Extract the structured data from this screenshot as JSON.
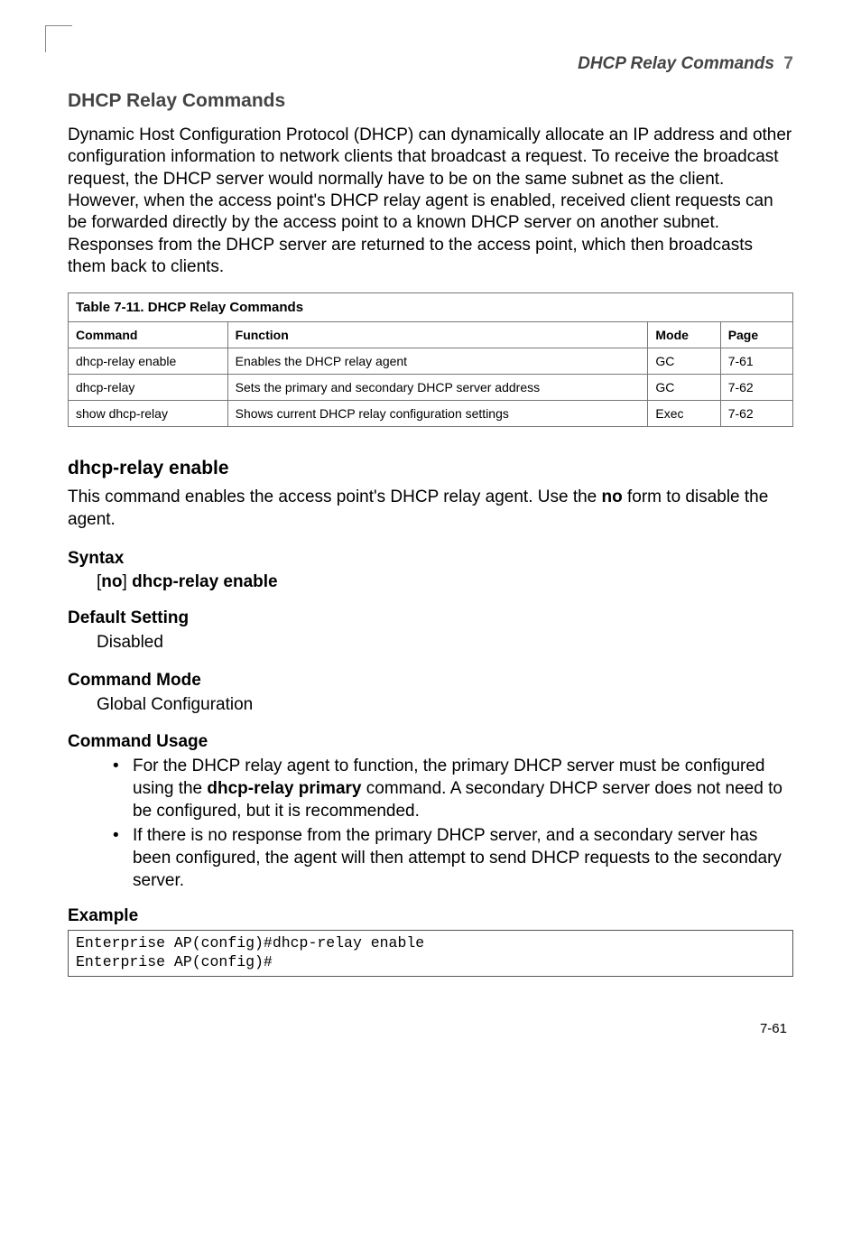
{
  "header": {
    "right": "DHCP Relay Commands",
    "chapter": "7"
  },
  "section": {
    "title": "DHCP Relay Commands",
    "intro": "Dynamic Host Configuration Protocol (DHCP) can dynamically allocate an IP address and other configuration information to network clients that broadcast a request. To receive the broadcast request, the DHCP server would normally have to be on the same subnet as the client. However, when the access point's DHCP relay agent is enabled, received client requests can be forwarded directly by the access point to a known DHCP server on another subnet. Responses from the DHCP server are returned to the access point, which then broadcasts them back to clients."
  },
  "table": {
    "caption": "Table 7-11. DHCP Relay Commands",
    "headers": [
      "Command",
      "Function",
      "Mode",
      "Page"
    ],
    "rows": [
      [
        "dhcp-relay enable",
        "Enables the DHCP relay agent",
        "GC",
        "7-61"
      ],
      [
        "dhcp-relay",
        "Sets the primary and secondary DHCP server address",
        "GC",
        "7-62"
      ],
      [
        "show dhcp-relay",
        "Shows current DHCP relay configuration settings",
        "Exec",
        "7-62"
      ]
    ]
  },
  "command": {
    "name": "dhcp-relay enable",
    "desc_before_no": "This command enables the access point's DHCP relay agent. Use the ",
    "no_keyword": "no",
    "desc_after_no": " form to disable the agent.",
    "syntax_label": "Syntax",
    "syntax_no": "no",
    "syntax_cmd": "dhcp-relay enable",
    "default_label": "Default Setting",
    "default_value": "Disabled",
    "mode_label": "Command Mode",
    "mode_value": "Global Configuration",
    "usage_label": "Command Usage",
    "usage1_a": "For the DHCP relay agent to function, the primary DHCP server must be configured using the ",
    "usage1_cmd": "dhcp-relay primary",
    "usage1_b": " command. A secondary DHCP server does not need to be configured, but it is recommended.",
    "usage2": "If there is no response from the primary DHCP server, and a secondary server has been configured, the agent will then attempt to send DHCP requests to the secondary server.",
    "example_label": "Example",
    "example_code": "Enterprise AP(config)#dhcp-relay enable\nEnterprise AP(config)#"
  },
  "page_number": "7-61"
}
